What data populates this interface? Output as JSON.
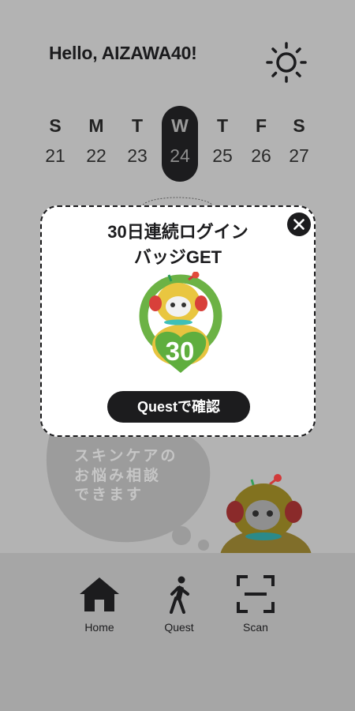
{
  "header": {
    "greeting": "Hello, AIZAWA40!",
    "theme_icon": "sun-icon"
  },
  "calendar": {
    "days": [
      {
        "dow": "S",
        "date": "21"
      },
      {
        "dow": "M",
        "date": "22"
      },
      {
        "dow": "T",
        "date": "23"
      },
      {
        "dow": "W",
        "date": "24"
      },
      {
        "dow": "T",
        "date": "25"
      },
      {
        "dow": "F",
        "date": "26"
      },
      {
        "dow": "S",
        "date": "27"
      }
    ]
  },
  "background": {
    "bubble_text": "スキンケアの\nお悩み相談\nできます"
  },
  "popup": {
    "title": "30日連続ログイン\nバッジGET",
    "badge_number": "30",
    "button_label": "Questで確認",
    "close_icon": "close-icon"
  },
  "tabbar": {
    "items": [
      {
        "label": "Home",
        "icon": "home-icon"
      },
      {
        "label": "Quest",
        "icon": "walking-icon"
      },
      {
        "label": "Scan",
        "icon": "scan-icon"
      }
    ]
  },
  "colors": {
    "dark": "#1c1c1e",
    "badge_green": "#6cb245",
    "mascot_yellow": "#e7c33f"
  }
}
